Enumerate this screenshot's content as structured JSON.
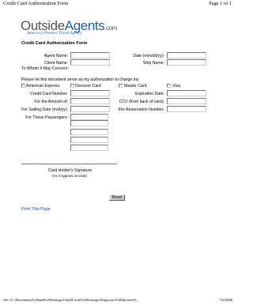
{
  "header": {
    "title": "Credit Card Authorization Form",
    "page": "Page 1 of 1"
  },
  "logo": {
    "name_part1": "Outside",
    "name_part2": "Agents",
    "name_suffix": ".com",
    "tagline": "America's Premier Travel Agency",
    "colors": {
      "gray": "#555555",
      "blue": "#1f5fb0"
    }
  },
  "form": {
    "title": "Credit Card Authorization Form",
    "agent_name_label": "Agent Name:",
    "date_label": "Date (mm/dd/yy):",
    "client_name_label": "Client Name:",
    "ship_name_label": "Ship Name:",
    "salutation": "To Whom It May Concern:",
    "authorization_text": "Please let this document serve as my authorization to charge my",
    "card_types": [
      "American Express",
      "Discover Card",
      "Master Card",
      "Visa"
    ],
    "credit_card_number_label": "Credit Card Number:",
    "expiration_date_label": "Expiration Date:",
    "amount_label": "For the Amount of:",
    "ccv_label": "CCV (from back of card):",
    "sailing_date_label": "For Sailing Date (m/d/yy):",
    "reservation_number_label": "For Reservation Number:",
    "passengers_label": "For These Passengers:",
    "signature_label": "Card Holder's Signature",
    "signature_note": "(As It Appears on Card)",
    "reset_label": "Reset",
    "print_link": "Print This Page"
  },
  "footer": {
    "path": "file://C:\\Documents%20and%20Settings\\Chad\\Local%20Settings\\Temporary%20Internet%...",
    "date": "7/6/2006"
  },
  "colors": {
    "link": "#1a3fd6",
    "button_face": "#d4d0c8"
  }
}
